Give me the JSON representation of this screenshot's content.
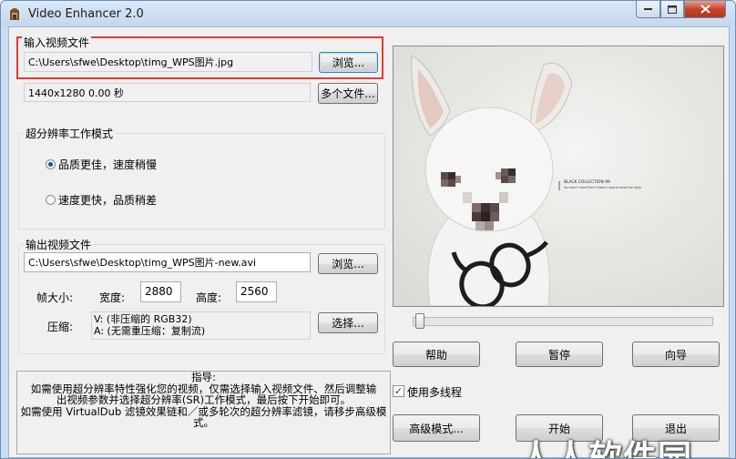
{
  "window": {
    "title": "Video Enhancer 2.0"
  },
  "input_group": {
    "legend": "输入视频文件",
    "file_path": "C:\\Users\\sfwe\\Desktop\\timg_WPS图片.jpg",
    "browse_label": "浏览...",
    "info": "1440x1280 0.00 秒",
    "multi_files_label": "多个文件..."
  },
  "mode_group": {
    "legend": "超分辨率工作模式",
    "options": [
      {
        "label": "品质更佳，速度稍慢",
        "selected": true
      },
      {
        "label": "速度更快，品质稍差",
        "selected": false
      }
    ]
  },
  "output_group": {
    "legend": "输出视频文件",
    "file_path": "C:\\Users\\sfwe\\Desktop\\timg_WPS图片-new.avi",
    "browse_label": "浏览...",
    "frame_size_label": "帧大小:",
    "width_label": "宽度:",
    "width_value": "2880",
    "height_label": "高度:",
    "height_value": "2560",
    "compression_label": "压缩:",
    "compression_video": "V: (非压缩的 RGB32)",
    "compression_audio": "A: (无需重压缩：复制流)",
    "select_label": "选择..."
  },
  "guide": {
    "title": "指导:",
    "lines": [
      "如需使用超分辨率特性强化您的视频，仅需选择输入视频文件、然后调整输",
      "出视频参数并选择超分辨率(SR)工作模式，最后按下开始即可。",
      "如需使用 VirtualDub 滤镜效果链和／或多轮次的超分辨率滤镜，请移步高级模式。"
    ]
  },
  "preview": {
    "caption_title": "BLACK COLLECTION 99",
    "caption_sub": "You don't need Paris Hilton's dog to have the style",
    "position": 0
  },
  "buttons": {
    "help": "帮助",
    "pause": "暂停",
    "wizard": "向导",
    "advanced": "高级模式...",
    "start": "开始",
    "exit": "退出"
  },
  "multithread": {
    "label": "使用多线程",
    "checked": true
  },
  "watermark": "人人软件园",
  "colors": {
    "highlight_box": "#e53935",
    "close_button": "#c7432a"
  }
}
